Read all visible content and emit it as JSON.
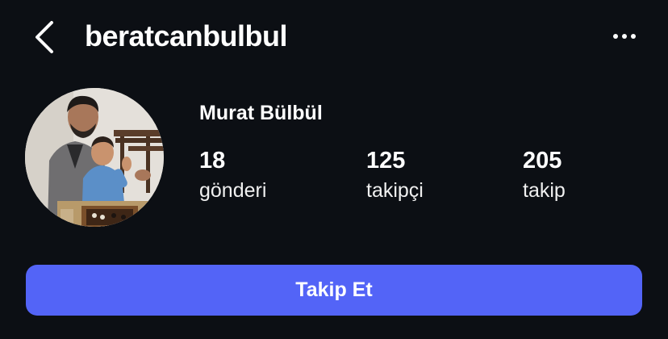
{
  "header": {
    "back_icon": "chevron-left-icon",
    "username": "beratcanbulbul",
    "more_icon": "more-horizontal-icon"
  },
  "profile": {
    "avatar_icon": "profile-photo",
    "display_name": "Murat Bülbül",
    "stats": {
      "posts": {
        "count": "18",
        "label": "gönderi"
      },
      "followers": {
        "count": "125",
        "label": "takipçi"
      },
      "following": {
        "count": "205",
        "label": "takip"
      }
    }
  },
  "actions": {
    "follow_label": "Takip Et"
  },
  "colors": {
    "background": "#0c0f14",
    "accent": "#5364f7",
    "text": "#ffffff"
  }
}
